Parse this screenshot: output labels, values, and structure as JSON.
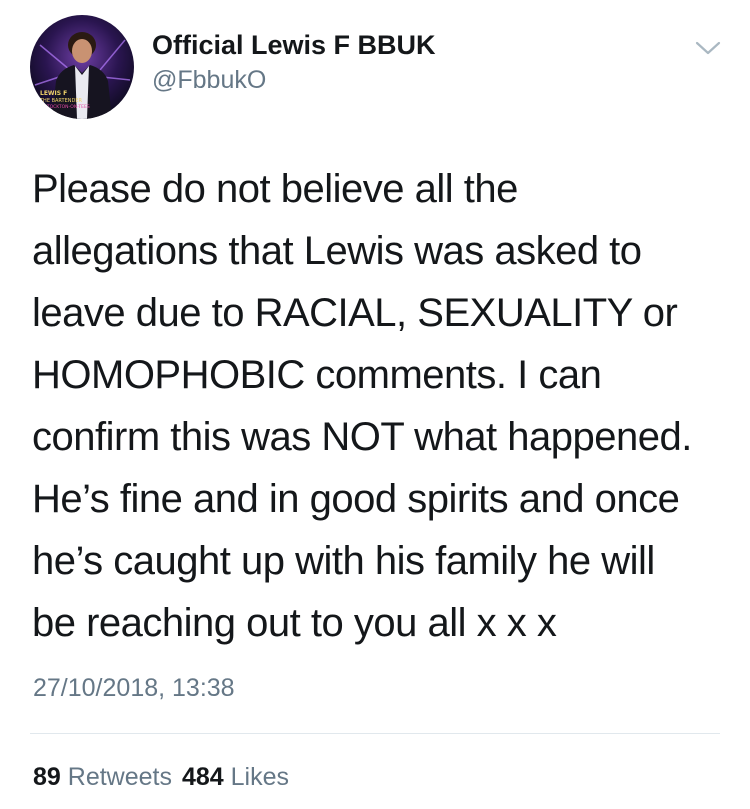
{
  "tweet": {
    "author": {
      "display_name": "Official Lewis F BBUK",
      "handle": "@FbbukO",
      "avatar_text": [
        "LEWIS F",
        "THE BARTENDER",
        "STOCKTON-ON-TEES"
      ]
    },
    "text_lines": [
      "Please do not believe all the",
      "allegations that Lewis was asked to",
      "leave due to RACIAL, SEXUALITY or",
      "HOMOPHOBIC comments. I can",
      "confirm this was NOT what happened.",
      "He’s fine and in good spirits and once",
      "he’s caught up with his family he will",
      "be reaching out to you all x x x"
    ],
    "timestamp": "27/10/2018, 13:38",
    "stats": {
      "retweets_count": "89",
      "retweets_label": "Retweets",
      "likes_count": "484",
      "likes_label": "Likes"
    }
  },
  "icons": {
    "more": "chevron-down-icon"
  },
  "colors": {
    "text_primary": "#14171a",
    "text_secondary": "#657786",
    "divider": "#e1e8ed",
    "background": "#ffffff"
  }
}
